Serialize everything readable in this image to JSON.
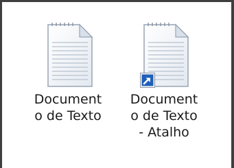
{
  "files": [
    {
      "label_lines": [
        "Document",
        "o de Texto"
      ],
      "icon": "text-document-icon",
      "shortcut": false
    },
    {
      "label_lines": [
        "Document",
        "o de Texto",
        "- Atalho"
      ],
      "icon": "text-document-icon",
      "shortcut": true,
      "overlay_icon": "shortcut-arrow-icon"
    }
  ],
  "colors": {
    "frame": "#3f3f3f",
    "page": "#f4f7fb",
    "page_border": "#9aa6b4",
    "lines": "#b8c3d0",
    "shortcut_blue": "#1f5fb9"
  }
}
